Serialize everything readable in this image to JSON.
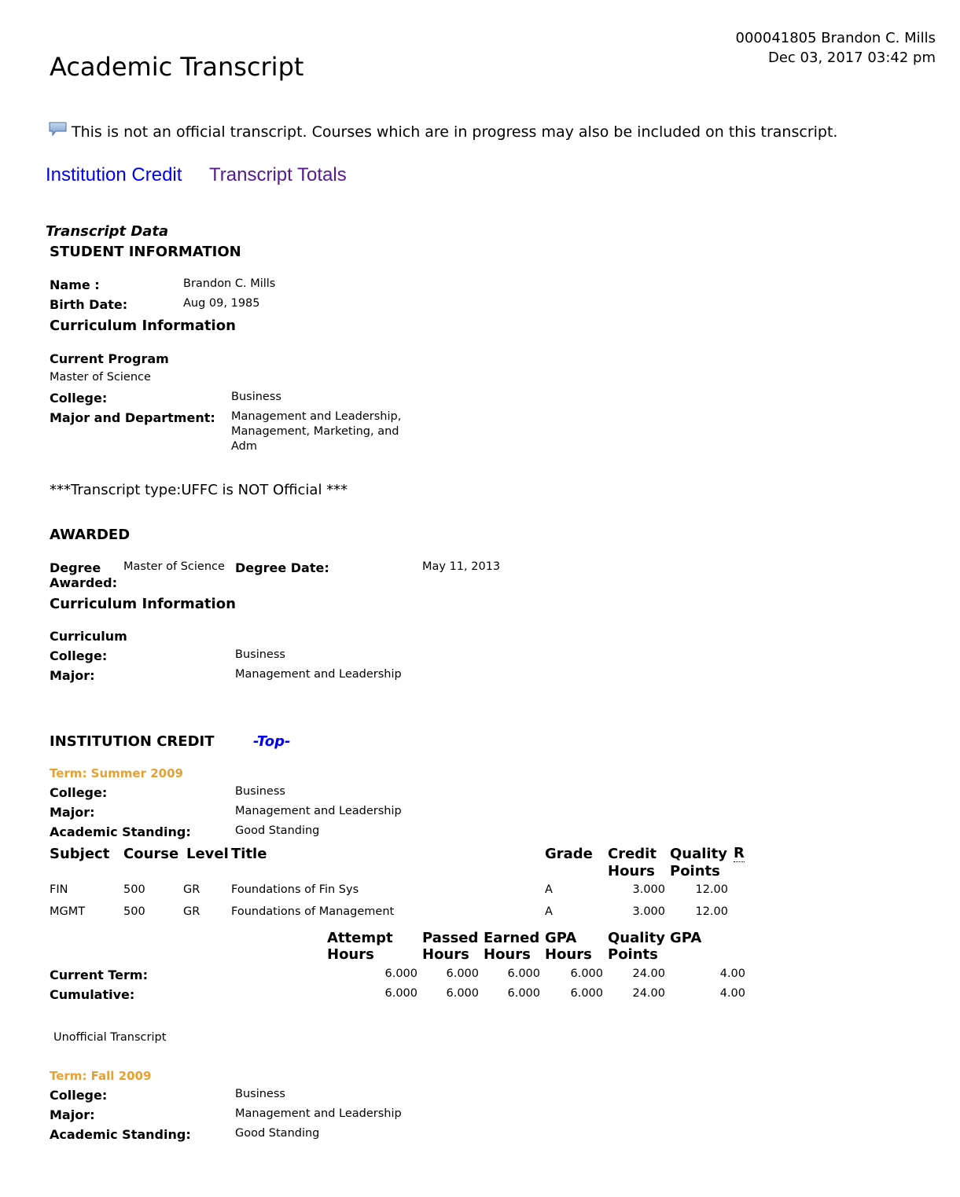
{
  "header": {
    "student_line": "000041805 Brandon C. Mills",
    "datetime": "Dec 03, 2017 03:42 pm",
    "title": "Academic Transcript"
  },
  "notice": {
    "icon": "comment-icon",
    "text": "This is not an official transcript. Courses which are in progress may also be included on this transcript."
  },
  "nav": {
    "institution_credit": "Institution Credit",
    "transcript_totals": "Transcript Totals"
  },
  "transcript_data_label": "Transcript Data",
  "student_info": {
    "heading": "STUDENT INFORMATION",
    "name_label": "Name :",
    "name_value": "Brandon C. Mills",
    "birth_label": "Birth Date:",
    "birth_value": "Aug 09, 1985",
    "curriculum_heading": "Curriculum Information",
    "current_program_label": "Current Program",
    "program_value": "Master of Science",
    "college_label": "College:",
    "college_value": "Business",
    "major_dept_label": "Major and Department:",
    "major_dept_lines": [
      "Management and Leadership,",
      "Management, Marketing, and",
      "Adm"
    ]
  },
  "transcript_type": "***Transcript type:UFFC is NOT Official ***",
  "awarded": {
    "heading": "AWARDED",
    "degree_label_1": "Degree",
    "degree_label_2": "Awarded:",
    "degree_value": "Master of Science",
    "degree_date_label": "Degree Date:",
    "degree_date_value": "May 11, 2013",
    "curriculum_heading": "Curriculum Information",
    "curriculum_label": "Curriculum",
    "college_label": "College:",
    "college_value": "Business",
    "major_label": "Major:",
    "major_value": "Management and Leadership"
  },
  "institution_credit": {
    "heading": "INSTITUTION CREDIT",
    "top_link": "-Top-",
    "terms": [
      {
        "term": "Term: Summer 2009",
        "college_label": "College:",
        "college_value": "Business",
        "major_label": "Major:",
        "major_value": "Management and Leadership",
        "standing_label": "Academic Standing:",
        "standing_value": "Good Standing",
        "columns": {
          "subject": "Subject",
          "course": "Course",
          "level": "Level",
          "title": "Title",
          "grade": "Grade",
          "credit_1": "Credit",
          "credit_2": "Hours",
          "quality_1": "Quality",
          "quality_2": "Points",
          "r": "R"
        },
        "courses": [
          {
            "subject": "FIN",
            "course": "500",
            "level": "GR",
            "title": "Foundations of Fin Sys",
            "grade": "A",
            "credit": "3.000",
            "points": "12.00"
          },
          {
            "subject": "MGMT",
            "course": "500",
            "level": "GR",
            "title": "Foundations of Management",
            "grade": "A",
            "credit": "3.000",
            "points": "12.00"
          }
        ],
        "totals_columns": {
          "attempt_1": "Attempt",
          "attempt_2": "Hours",
          "passed_1": "Passed",
          "passed_2": "Hours",
          "earned_1": "Earned",
          "earned_2": "Hours",
          "gpa_hours_1": "GPA",
          "gpa_hours_2": "Hours",
          "quality_1": "Quality",
          "quality_2": "Points",
          "gpa": "GPA"
        },
        "totals": [
          {
            "label": "Current Term:",
            "attempt": "6.000",
            "passed": "6.000",
            "earned": "6.000",
            "gpa_hours": "6.000",
            "points": "24.00",
            "gpa": "4.00"
          },
          {
            "label": "Cumulative:",
            "attempt": "6.000",
            "passed": "6.000",
            "earned": "6.000",
            "gpa_hours": "6.000",
            "points": "24.00",
            "gpa": "4.00"
          }
        ],
        "footer": "Unofficial Transcript"
      },
      {
        "term": "Term: Fall 2009",
        "college_label": "College:",
        "college_value": "Business",
        "major_label": "Major:",
        "major_value": "Management and Leadership",
        "standing_label": "Academic Standing:",
        "standing_value": "Good Standing"
      }
    ]
  }
}
